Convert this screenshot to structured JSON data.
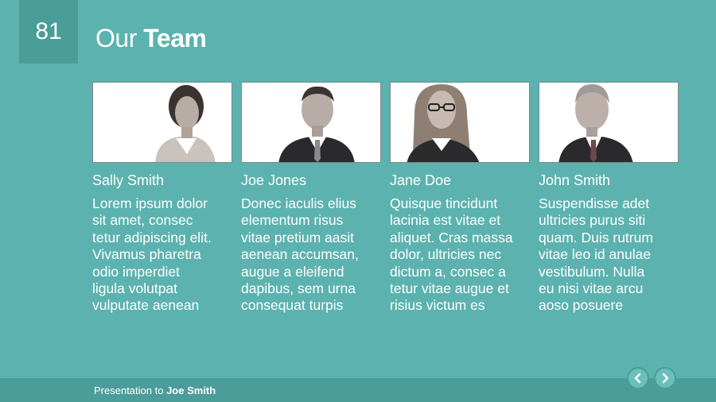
{
  "slide": {
    "number": "81"
  },
  "title": {
    "light": "Our",
    "bold": "Team"
  },
  "members": [
    {
      "name": "Sally Smith",
      "bio": [
        "Lorem ipsum dolor",
        "sit amet, consec",
        "tetur adipiscing elit.",
        "Vivamus pharetra",
        "odio imperdiet",
        "ligula volutpat",
        "vulputate aenean"
      ]
    },
    {
      "name": "Joe Jones",
      "bio": [
        "Donec iaculis elius",
        "elementum risus",
        "vitae pretium aasit",
        "aenean accumsan,",
        "augue a eleifend",
        "dapibus, sem urna",
        "consequat turpis"
      ]
    },
    {
      "name": "Jane Doe",
      "bio": [
        "Quisque tincidunt",
        "lacinia est vitae et",
        "aliquet. Cras massa",
        "dolor, ultricies nec",
        "dictum a, consec a",
        "tetur vitae augue et",
        "risius victum es"
      ]
    },
    {
      "name": "John Smith",
      "bio": [
        "Suspendisse adet",
        "ultricies purus siti",
        "quam. Duis rutrum",
        "vitae leo id anulae",
        "vestibulum. Nulla",
        "eu nisi vitae arcu",
        "aoso posuere"
      ]
    }
  ],
  "footer": {
    "prefix": "Presentation to",
    "recipient": "Joe Smith"
  },
  "nav": {
    "prev_icon": "chevron-left-icon",
    "next_icon": "chevron-right-icon"
  },
  "colors": {
    "background": "#5cb2ae",
    "accent": "#4a9d99"
  }
}
